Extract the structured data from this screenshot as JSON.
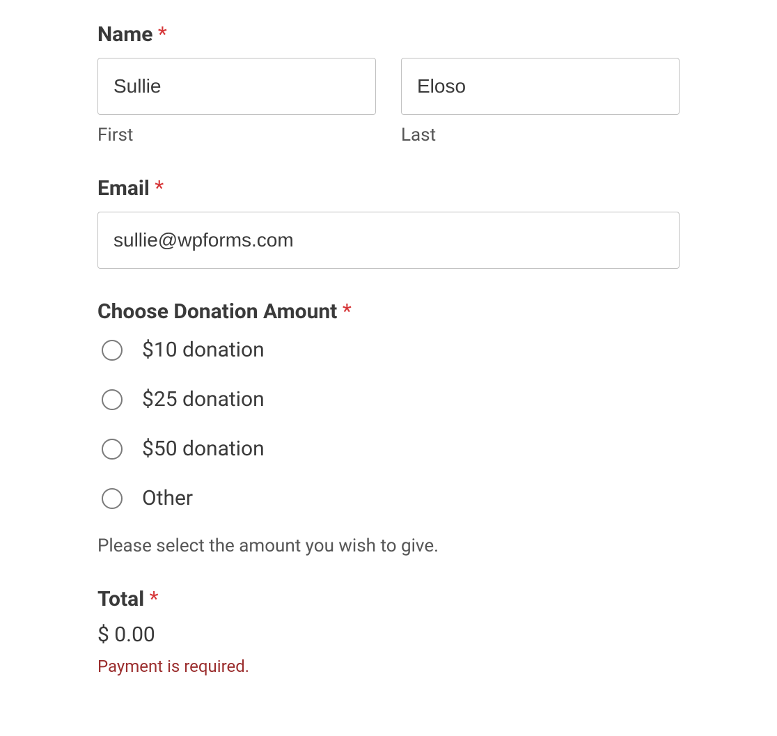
{
  "name": {
    "label": "Name",
    "first_sublabel": "First",
    "last_sublabel": "Last",
    "first_value": "Sullie",
    "last_value": "Eloso"
  },
  "email": {
    "label": "Email",
    "value": "sullie@wpforms.com"
  },
  "donation": {
    "label": "Choose Donation Amount",
    "options": [
      "$10 donation",
      "$25 donation",
      "$50 donation",
      "Other"
    ],
    "help_text": "Please select the amount you wish to give."
  },
  "total": {
    "label": "Total",
    "value": "$ 0.00",
    "error": "Payment is required."
  },
  "required_mark": "*"
}
